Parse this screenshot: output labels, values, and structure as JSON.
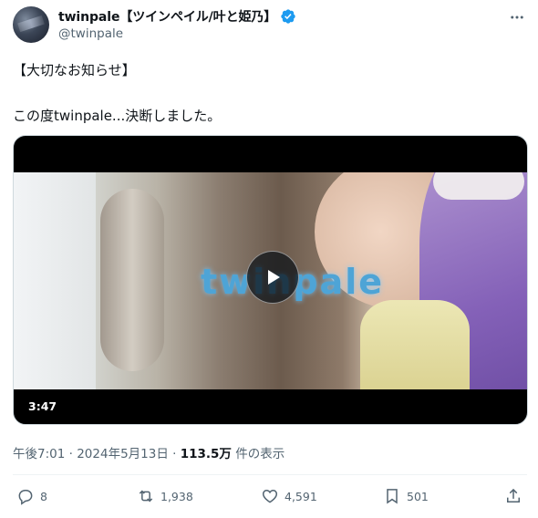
{
  "author": {
    "display_name": "twinpale【ツインペイル/叶と姫乃】",
    "handle": "@twinpale"
  },
  "tweet": {
    "line1": "【大切なお知らせ】",
    "line2": "この度twinpale...決断しました。"
  },
  "media": {
    "wordmark": "twinpale",
    "duration": "3:47"
  },
  "meta": {
    "time": "午後7:01",
    "date": "2024年5月13日",
    "separator": "·",
    "views": "113.5万",
    "views_suffix": "件の表示"
  },
  "actions": {
    "replies": "8",
    "retweets": "1,938",
    "likes": "4,591",
    "bookmarks": "501"
  },
  "colors": {
    "verified": "#1d9bf0",
    "secondary_text": "#536471",
    "primary_text": "#0f1419"
  }
}
